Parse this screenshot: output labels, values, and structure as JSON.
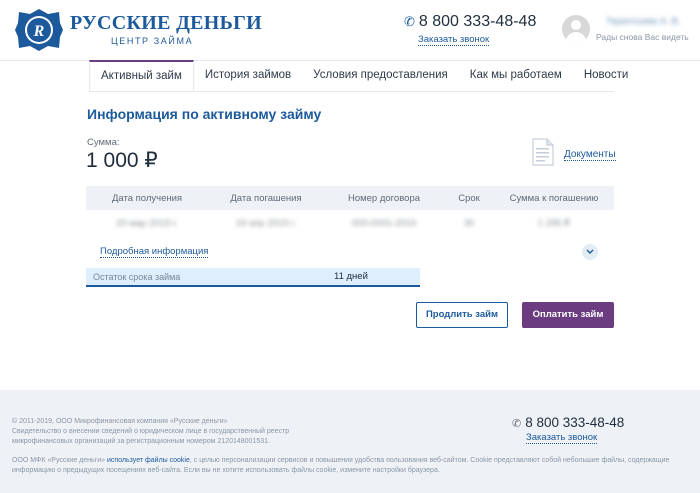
{
  "header": {
    "brand_name": "РУССКИЕ ДЕНЬГИ",
    "brand_sub": "ЦЕНТР ЗАЙМА",
    "phone": "8 800 333-48-48",
    "callback": "Заказать звонок",
    "user_name": "Терентьева А. В.",
    "greeting": "Рады снова Вас видеть"
  },
  "tabs": [
    {
      "label": "Активный займ",
      "active": true
    },
    {
      "label": "История займов"
    },
    {
      "label": "Условия предоставления"
    },
    {
      "label": "Как мы работаем"
    },
    {
      "label": "Новости"
    }
  ],
  "main": {
    "title": "Информация по активному займу",
    "amount_label": "Сумма:",
    "amount": "1 000 ₽",
    "documents": "Документы",
    "table": {
      "headers": [
        "Дата получения",
        "Дата погашения",
        "Номер договора",
        "Срок",
        "Сумма к погашению"
      ],
      "row": [
        "20 мар 2019 г.",
        "19 апр 2019 г.",
        "000-0001-2019",
        "30",
        "1 295 ₽"
      ]
    },
    "more_info": "Подробная информация",
    "term_label": "Остаток срока займа",
    "term_value": "11 дней",
    "extend_button": "Продлить займ",
    "pay_button": "Оплатить займ"
  },
  "footer": {
    "copyright": "© 2011-2019, ООО Микрофинансовая компания «Русские деньги»",
    "cert_line1": "Свидетельство о внесении сведений о юридическом лице в государственный реестр",
    "cert_line2": "микрофинансовых организаций за регистрационным номером 2120148001531.",
    "phone": "8 800 333-48-48",
    "callback": "Заказать звонок",
    "cookie_prefix": "ООО МФК «Русские деньги»",
    "cookie_link": "использует файлы cookie",
    "cookie_text": ", с целью персонализации сервисов и повышения удобства пользования веб-сайтом. Cookie представляют собой небольшие файлы, содержащие информацию о предыдущих посещениях веб-сайта. Если вы не хотите использовать файлы cookie, измените настройки браузера."
  },
  "colors": {
    "brand_blue": "#1d5a9c",
    "accent_purple": "#6b3d80",
    "term_bar_bg": "#dfeefd"
  }
}
